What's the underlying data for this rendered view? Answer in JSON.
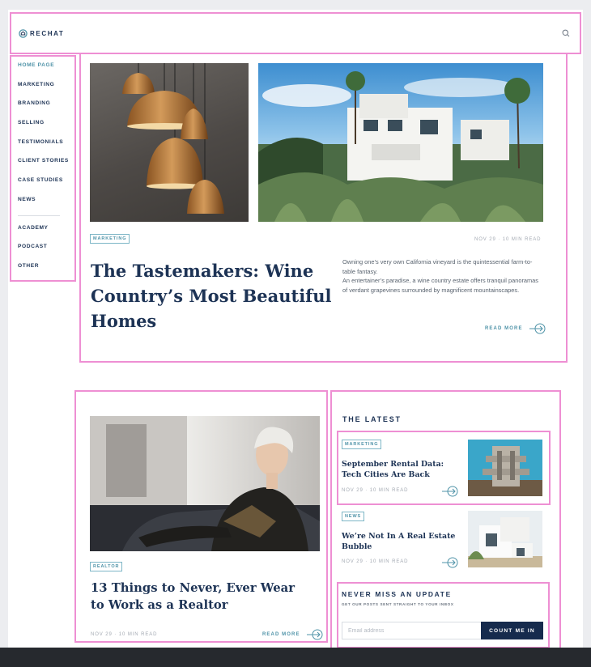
{
  "brand": {
    "name": "RECHAT"
  },
  "colors": {
    "navy": "#1d3355",
    "teal": "#4f93a8",
    "highlight": "#ee8fd3",
    "button": "#162b4d"
  },
  "sidebar": {
    "items": [
      {
        "label": "HOME PAGE",
        "active": true
      },
      {
        "label": "MARKETING"
      },
      {
        "label": "BRANDING"
      },
      {
        "label": "SELLING"
      },
      {
        "label": "TESTIMONIALS"
      },
      {
        "label": "CLIENT STORIES"
      },
      {
        "label": "CASE STUDIES"
      },
      {
        "label": "NEWS"
      }
    ],
    "secondary": [
      {
        "label": "ACADEMY"
      },
      {
        "label": "PODCAST"
      },
      {
        "label": "OTHER"
      }
    ]
  },
  "hero": {
    "tag": "MARKETING",
    "meta": "NOV 29 · 10 MIN READ",
    "title": "The Tastemakers: Wine Country’s Most Beautiful Homes",
    "excerpt": "Owning one’s very own California vineyard is the quintessential farm-to-table fantasy.\nAn entertainer’s paradise, a wine country estate offers tranquil panoramas of verdant grapevines surrounded by magnificent mountainscapes.",
    "read_more": "READ MORE"
  },
  "feature": {
    "tag": "REALTOR",
    "title": "13 Things to Never, Ever Wear to Work as a Realtor",
    "meta": "NOV 29 · 10 MIN READ",
    "read_more": "READ MORE"
  },
  "latest": {
    "heading": "THE LATEST",
    "posts": [
      {
        "tag": "MARKETING",
        "title": "September Rental Data: Tech Cities Are Back",
        "meta": "NOV 29 · 10 MIN READ"
      },
      {
        "tag": "NEWS",
        "title": "We’re Not In A Real Estate Bubble",
        "meta": "NOV 29 · 10 MIN READ"
      }
    ]
  },
  "newsletter": {
    "title": "NEVER MISS AN UPDATE",
    "subtitle": "GET OUR POSTS SENT STRAIGHT TO YOUR INBOX",
    "placeholder": "Email address",
    "button": "COUNT ME IN"
  }
}
